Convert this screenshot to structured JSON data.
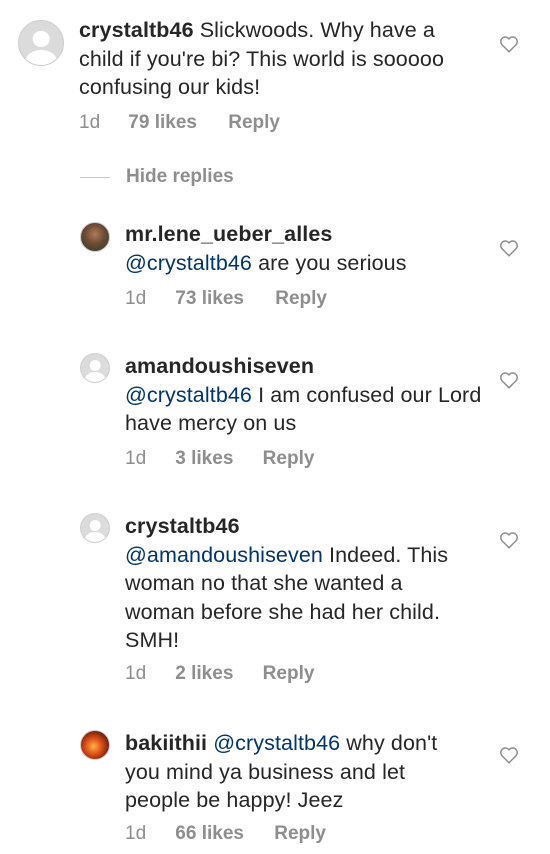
{
  "comments": [
    {
      "username": "crystaltb46",
      "mention": "",
      "text": "Slickwoods. Why have a child if you're bi? This world is sooooo confusing our kids!",
      "time": "1d",
      "likes": "79 likes",
      "reply": "Reply",
      "avatar": "default"
    },
    {
      "username": "mr.lene_ueber_alles",
      "mention": "@crystaltb46",
      "text": "are you serious",
      "time": "1d",
      "likes": "73 likes",
      "reply": "Reply",
      "avatar": "photo"
    },
    {
      "username": "amandoushiseven",
      "mention": "@crystaltb46",
      "text": "I am confused our Lord have mercy on us",
      "time": "1d",
      "likes": "3 likes",
      "reply": "Reply",
      "avatar": "default"
    },
    {
      "username": "crystaltb46",
      "mention": "@amandoushiseven",
      "text": "Indeed. This woman no that she wanted a woman before she had her child. SMH!",
      "time": "1d",
      "likes": "2 likes",
      "reply": "Reply",
      "avatar": "default"
    },
    {
      "username": "bakiithii",
      "mention": "@crystaltb46",
      "text": "why don't you mind ya business and let people be happy! Jeez",
      "time": "1d",
      "likes": "66 likes",
      "reply": "Reply",
      "avatar": "photo"
    }
  ],
  "hide_replies": "Hide replies",
  "colors": {
    "text": "#262626",
    "mention": "#003569",
    "meta": "#8e8e8e"
  }
}
